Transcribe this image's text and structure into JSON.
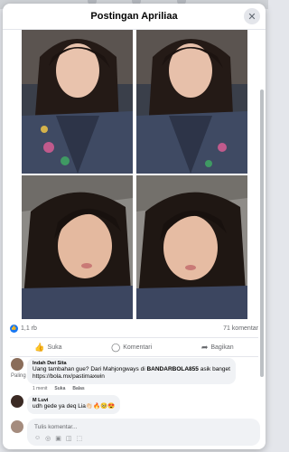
{
  "modal": {
    "title": "Postingan Apriliaa",
    "close_glyph": "✕"
  },
  "post": {
    "reaction_count": "1,1 rb",
    "comment_count": "71 komentar",
    "actions": {
      "like": "Suka",
      "comment": "Komentari",
      "share": "Bagikan"
    }
  },
  "comments_sort": "Paling relevan",
  "comments": [
    {
      "author": "Indah Dwi Sita",
      "text_1": "Uang tambahan gue? Dari Mahjongways di ",
      "text_bold": "BANDARBOLA855",
      "text_2": " asik banget",
      "text_3": "https://bola.mx/pastimaxwin",
      "time": "1 menit",
      "like": "Suka",
      "reply": "Balas"
    },
    {
      "author": "M Luvi",
      "text": "udh gede ya deq Lia👏🏻🔥🥺😍"
    }
  ],
  "composer": {
    "placeholder": "Tulis komentar...",
    "icons": [
      "emoji-icon",
      "camera-icon",
      "gif-icon",
      "sticker-icon",
      "more-icon"
    ]
  },
  "colors": {
    "accent": "#1877f2",
    "bubble": "#f0f2f5",
    "muted": "#65676b"
  }
}
